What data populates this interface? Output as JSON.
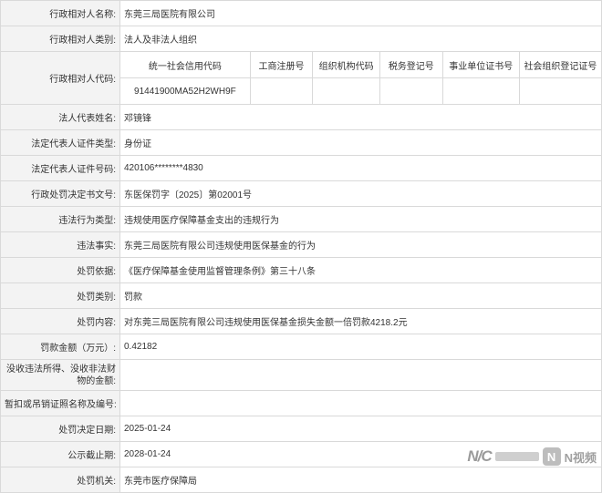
{
  "rows": [
    {
      "label": "行政相对人名称:",
      "value": "东莞三局医院有限公司"
    },
    {
      "label": "行政相对人类别:",
      "value": "法人及非法人组织"
    },
    {
      "label": "行政相对人代码:"
    },
    {
      "label": "法人代表姓名:",
      "value": "邓镜锋"
    },
    {
      "label": "法定代表人证件类型:",
      "value": "身份证"
    },
    {
      "label": "法定代表人证件号码:",
      "value": "420106********4830"
    },
    {
      "label": "行政处罚决定书文号:",
      "value": "东医保罚字〔2025〕第02001号"
    },
    {
      "label": "违法行为类型:",
      "value": "违规使用医疗保障基金支出的违规行为"
    },
    {
      "label": "违法事实:",
      "value": "东莞三局医院有限公司违规使用医保基金的行为"
    },
    {
      "label": "处罚依据:",
      "value": "《医疗保障基金使用监督管理条例》第三十八条"
    },
    {
      "label": "处罚类别:",
      "value": "罚款"
    },
    {
      "label": "处罚内容:",
      "value": "对东莞三局医院有限公司违规使用医保基金损失金额一倍罚款4218.2元"
    },
    {
      "label": "罚款金额（万元）:",
      "value": "0.42182"
    },
    {
      "label": "没收违法所得、没收非法财物的金额:",
      "value": ""
    },
    {
      "label": "暂扣或吊销证照名称及编号:",
      "value": ""
    },
    {
      "label": "处罚决定日期:",
      "value": "2025-01-24"
    },
    {
      "label": "公示截止期:",
      "value": "2028-01-24"
    },
    {
      "label": "处罚机关:",
      "value": "东莞市医疗保障局"
    }
  ],
  "codes": {
    "headers": [
      "统一社会信用代码",
      "工商注册号",
      "组织机构代码",
      "税务登记号",
      "事业单位证书号",
      "社会组织登记证号"
    ],
    "values": [
      "91441900MA52H2WH9F",
      "",
      "",
      "",
      "",
      ""
    ]
  },
  "watermark": {
    "brand_text": "N视频"
  }
}
